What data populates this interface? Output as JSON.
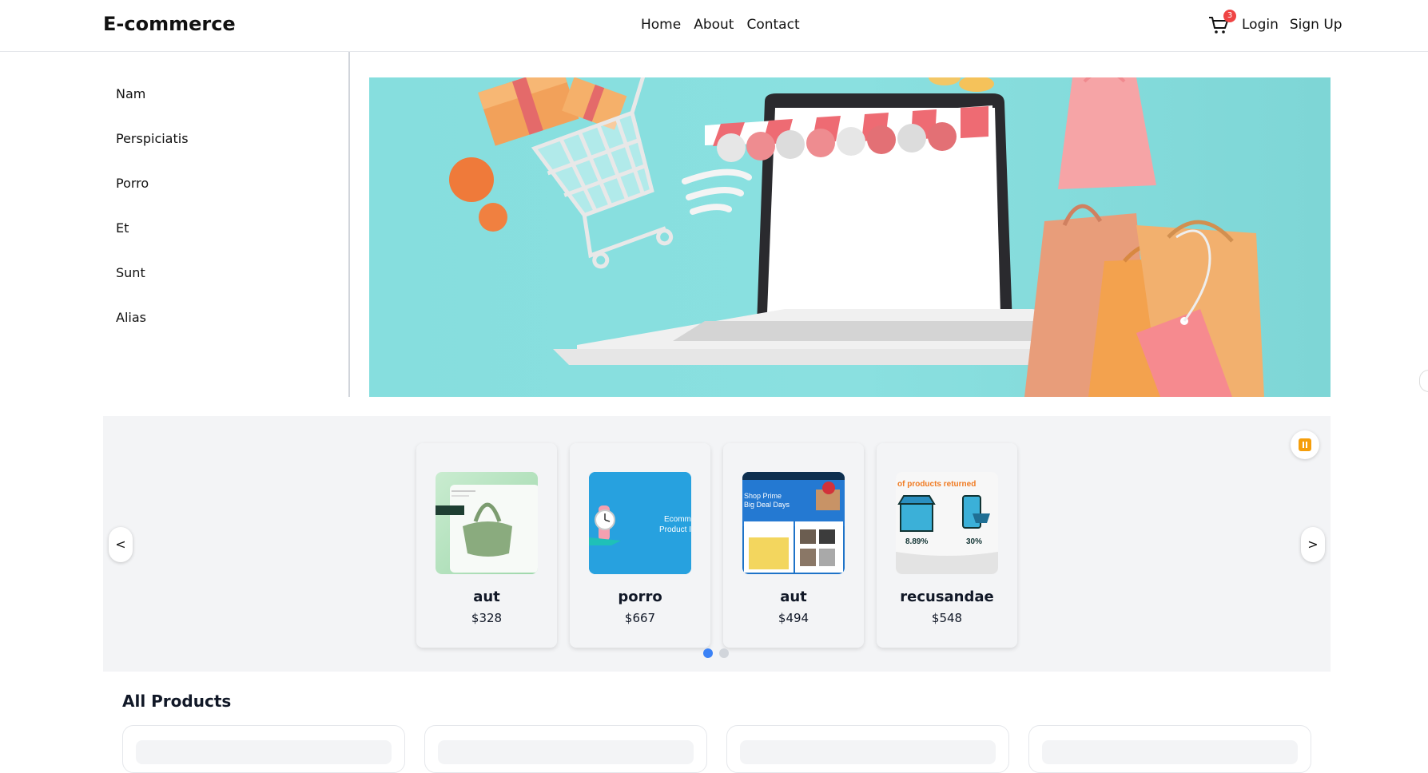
{
  "header": {
    "logo": "E-commerce",
    "nav": [
      "Home",
      "About",
      "Contact"
    ],
    "cart_count": "3",
    "login": "Login",
    "signup": "Sign Up"
  },
  "sidebar": {
    "items": [
      "Nam",
      "Perspiciatis",
      "Porro",
      "Et",
      "Sunt",
      "Alias"
    ]
  },
  "carousel": {
    "prev": "<",
    "next": ">",
    "products": [
      {
        "name": "aut",
        "price": "$328"
      },
      {
        "name": "porro",
        "price": "$667"
      },
      {
        "name": "aut",
        "price": "$494"
      },
      {
        "name": "recusandae",
        "price": "$548"
      }
    ],
    "image_text": {
      "card2": [
        "Ecomm",
        "Product I"
      ],
      "card3": [
        "Shop Prime",
        "Big Deal Days"
      ],
      "card4": [
        "of products returned",
        "8.89%",
        "30%"
      ]
    }
  },
  "all_products": {
    "title": "All Products"
  },
  "colors": {
    "accent": "#3b82f6",
    "badge": "#ef4444",
    "pause": "#f59e0b",
    "hero_bg": "#86dede"
  }
}
